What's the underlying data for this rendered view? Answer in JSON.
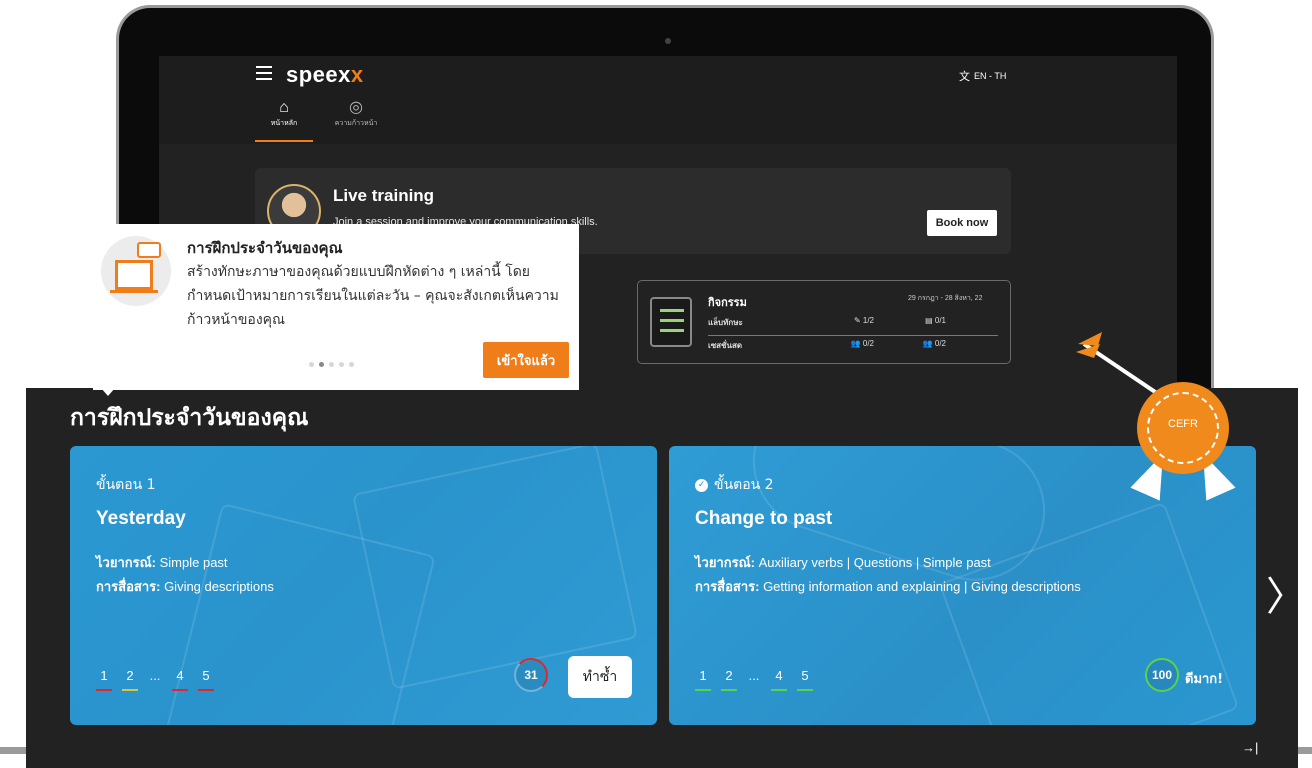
{
  "app": {
    "logo_main": "speex",
    "logo_accent": "x",
    "language": "EN - TH"
  },
  "nav": {
    "items": [
      {
        "label": "หน้าหลัก",
        "icon": "home-icon"
      },
      {
        "label": "ความก้าวหน้า",
        "icon": "progress-icon"
      }
    ]
  },
  "live_training": {
    "title": "Live training",
    "subtitle": "Join a session and improve your communication skills.",
    "button": "Book now"
  },
  "activity": {
    "title": "กิจกรรม",
    "date_range": "29 กรกฎา - 28 สิงหา, 22",
    "rows": [
      {
        "label": "แล็บทักษะ",
        "v1": "✎ 1/2",
        "v2": "▤ 0/1"
      },
      {
        "label": "เซสชั่นสด",
        "v1": "👥 0/2",
        "v2": "👥 0/2"
      }
    ]
  },
  "tooltip": {
    "title": "การฝึกประจำวันของคุณ",
    "body": "สร้างทักษะภาษาของคุณด้วยแบบฝึกหัดต่าง ๆ เหล่านี้ โดยกำหนดเป้าหมายการเรียนในแต่ละวัน – คุณจะสังเกตเห็นความก้าวหน้าของคุณ",
    "button": "เข้าใจแล้ว",
    "dots_total": 5,
    "dots_active_index": 1
  },
  "panel": {
    "title": "การฝึกประจำวันของคุณ",
    "cards": [
      {
        "step": "ขั้นตอน 1",
        "title": "Yesterday",
        "grammar_label": "ไวยากรณ์:",
        "grammar_value": " Simple past",
        "comm_label": "การสื่อสาร:",
        "comm_value": " Giving descriptions",
        "steps": [
          "1",
          "2",
          "...",
          "4",
          "5"
        ],
        "score": "31",
        "action": "ทำซ้ำ"
      },
      {
        "step": "ขั้นตอน 2",
        "title": "Change to past",
        "grammar_label": "ไวยากรณ์:",
        "grammar_value": " Auxiliary verbs | Questions | Simple past",
        "comm_label": "การสื่อสาร:",
        "comm_value": " Getting information and explaining | Giving descriptions",
        "steps": [
          "1",
          "2",
          "...",
          "4",
          "5"
        ],
        "score": "100",
        "action": "ดีมาก!"
      }
    ],
    "next_arrow": "〉",
    "collapse": "→|"
  },
  "badge": {
    "label": "CEFR",
    "color": "#f08a1c"
  },
  "colors": {
    "accent": "#ef7d1a",
    "card_blue": "#2a95cf",
    "panel_bg": "#222222",
    "fail": "#e3262c",
    "warn": "#e0c13a",
    "pass": "#59d34a"
  }
}
